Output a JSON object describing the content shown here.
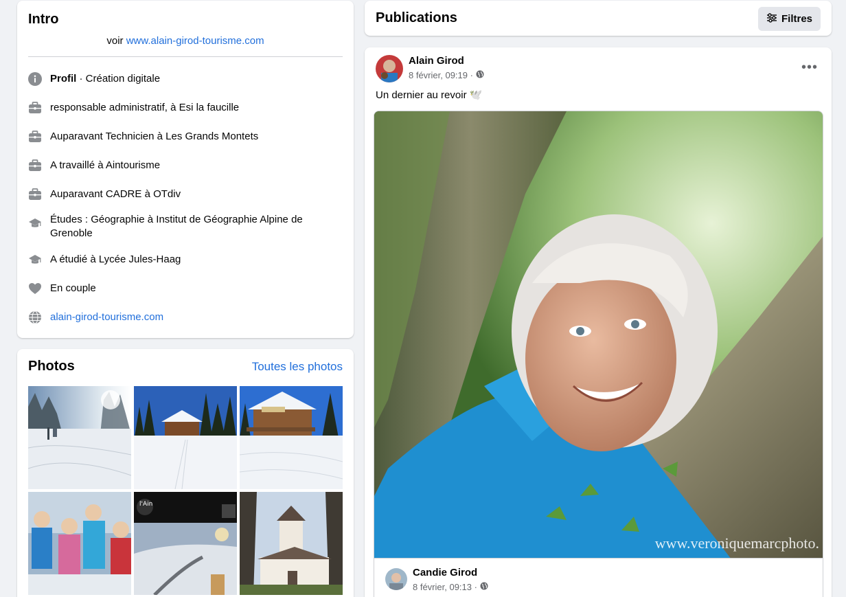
{
  "intro": {
    "title": "Intro",
    "bio_prefix": "voir ",
    "bio_link": "www.alain-girod-tourisme.com",
    "items": [
      {
        "icon": "info-icon",
        "bold": "Profil",
        "text": " · Création digitale"
      },
      {
        "icon": "briefcase-icon",
        "bold": "",
        "text": "responsable administratif, à Esi la faucille"
      },
      {
        "icon": "briefcase-icon",
        "bold": "",
        "text": "Auparavant Technicien à Les Grands Montets"
      },
      {
        "icon": "briefcase-icon",
        "bold": "",
        "text": "A travaillé à Aintourisme"
      },
      {
        "icon": "briefcase-icon",
        "bold": "",
        "text": "Auparavant CADRE à OTdiv"
      },
      {
        "icon": "graduation-cap-icon",
        "bold": "",
        "text": "Études : Géographie à Institut de Géographie Alpine de Grenoble"
      },
      {
        "icon": "graduation-cap-icon",
        "bold": "",
        "text": "A étudié à Lycée Jules-Haag"
      },
      {
        "icon": "heart-icon",
        "bold": "",
        "text": "En couple"
      },
      {
        "icon": "globe-icon",
        "bold": "",
        "text": "alain-girod-tourisme.com"
      }
    ]
  },
  "photos": {
    "title": "Photos",
    "see_all": "Toutes les photos"
  },
  "publications": {
    "title": "Publications",
    "filters_label": "Filtres"
  },
  "post": {
    "author": "Alain Girod",
    "date": "8 février, 09:19 ·",
    "text": "Un dernier au revoir 🕊️",
    "more": "•••",
    "watermark": "www.veroniquemarcphoto.",
    "shared_author": "Candie Girod",
    "shared_date": "8 février, 09:13 ·"
  },
  "colors": {
    "link": "#216fdb",
    "background": "#f0f2f5",
    "icon_gray": "#65676b"
  }
}
